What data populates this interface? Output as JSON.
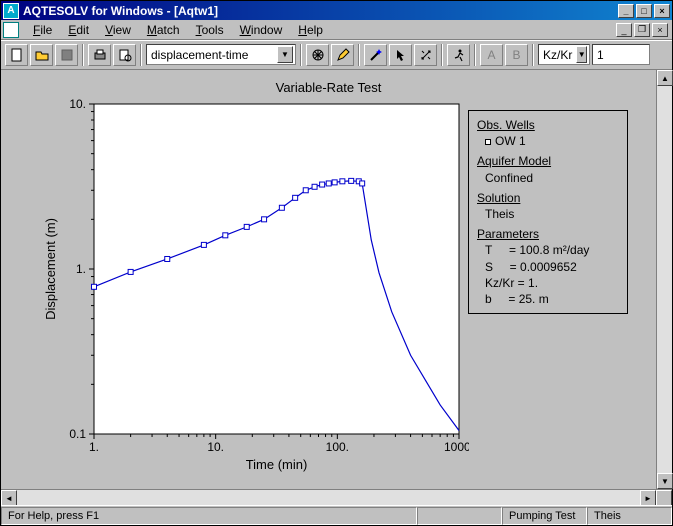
{
  "window": {
    "title": "AQTESOLV for Windows - [Aqtw1]"
  },
  "menu": {
    "file": "File",
    "edit": "Edit",
    "view": "View",
    "match": "Match",
    "tools": "Tools",
    "window": "Window",
    "help": "Help"
  },
  "toolbar": {
    "combo_main": "displacement-time",
    "combo_ratio": "Kz/Kr",
    "ratio_value": "1"
  },
  "status": {
    "help": "For Help, press F1",
    "mode": "Pumping Test",
    "solution": "Theis"
  },
  "chart_data": {
    "type": "line",
    "title": "Variable-Rate Test",
    "xlabel": "Time (min)",
    "ylabel": "Displacement (m)",
    "xscale": "log",
    "yscale": "log",
    "xlim": [
      1,
      1000
    ],
    "ylim": [
      0.1,
      10
    ],
    "xticks": [
      "1.",
      "10.",
      "100.",
      "1000."
    ],
    "yticks": [
      "0.1",
      "1.",
      "10."
    ],
    "series": [
      {
        "name": "OW 1",
        "x": [
          1,
          2,
          4,
          8,
          12,
          18,
          25,
          35,
          45,
          55,
          65,
          75,
          85,
          95,
          110,
          130,
          150,
          160,
          170,
          190,
          220,
          280,
          400,
          700,
          1000
        ],
        "y": [
          0.78,
          0.96,
          1.15,
          1.4,
          1.6,
          1.8,
          2.0,
          2.35,
          2.7,
          3.0,
          3.15,
          3.25,
          3.3,
          3.35,
          3.4,
          3.42,
          3.4,
          3.3,
          2.5,
          1.5,
          0.95,
          0.55,
          0.3,
          0.15,
          0.105
        ],
        "markers_until_index": 17
      }
    ]
  },
  "info": {
    "obs_wells_hdr": "Obs. Wells",
    "obs_wells": [
      "OW 1"
    ],
    "aquifer_model_hdr": "Aquifer Model",
    "aquifer_model": "Confined",
    "solution_hdr": "Solution",
    "solution": "Theis",
    "parameters_hdr": "Parameters",
    "params": {
      "T": "100.8 m²/day",
      "S": "0.0009652",
      "KzKr": "1.",
      "b": "25. m"
    }
  }
}
